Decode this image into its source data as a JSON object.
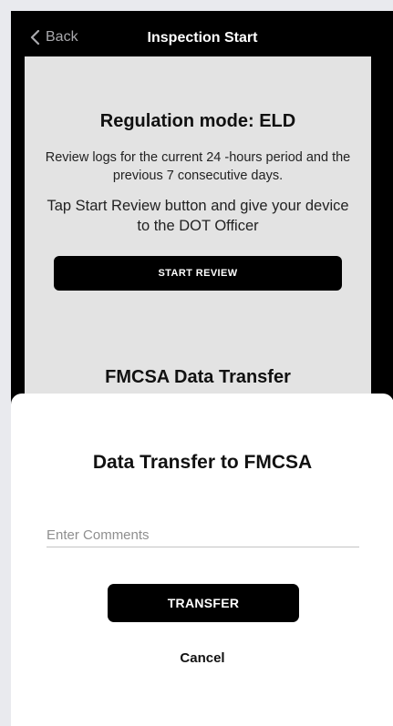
{
  "nav": {
    "back_label": "Back",
    "title": "Inspection Start"
  },
  "card": {
    "title": "Regulation mode: ELD",
    "description": "Review logs for the current 24 -hours period and the previous 7 consecutive days.",
    "instruction": "Tap Start Review button and give your device to the DOT Officer",
    "start_review_label": "START REVIEW",
    "section2_title": "FMCSA Data Transfer"
  },
  "sheet": {
    "title": "Data Transfer to FMCSA",
    "comments_placeholder": "Enter Comments",
    "comments_value": "",
    "transfer_label": "TRANSFER",
    "cancel_label": "Cancel"
  },
  "icons": {
    "back": "chevron-left-icon"
  }
}
